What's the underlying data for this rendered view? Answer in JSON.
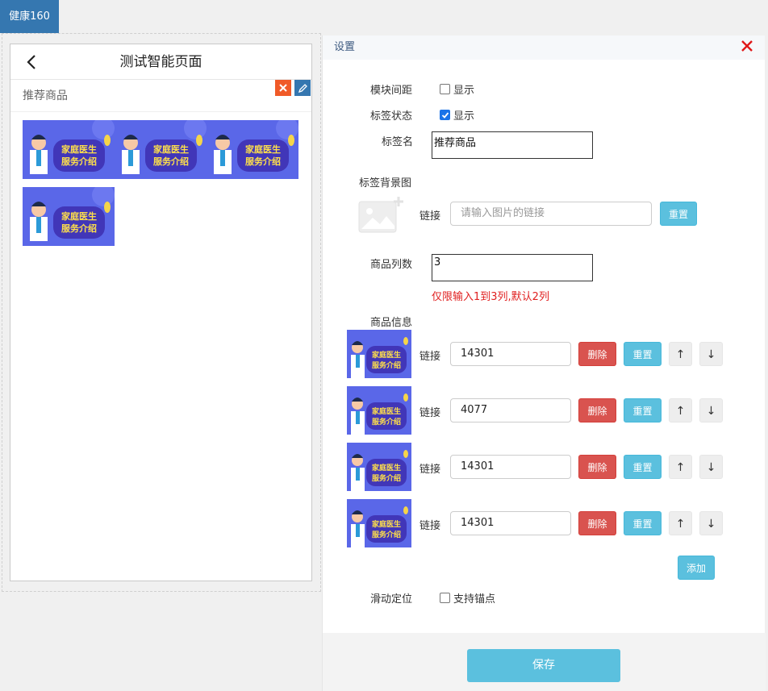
{
  "brand": "健康160",
  "phone": {
    "title": "测试智能页面",
    "module_label": "推荐商品",
    "product_banner_text_1": "家庭医生",
    "product_banner_text_2": "服务介绍"
  },
  "panel": {
    "title": "设置",
    "module_spacing_label": "模块间距",
    "module_spacing_option": "显示",
    "module_spacing_checked": false,
    "tag_status_label": "标签状态",
    "tag_status_option": "显示",
    "tag_status_checked": true,
    "tag_name_label": "标签名",
    "tag_name_value": "推荐商品",
    "tag_bg_label": "标签背景图",
    "link_label": "链接",
    "tag_bg_placeholder": "请输入图片的链接",
    "reset_label": "重置",
    "columns_label": "商品列数",
    "columns_value": "3",
    "columns_hint": "仅限输入1到3列,默认2列",
    "products_label": "商品信息",
    "products": [
      {
        "link": "14301"
      },
      {
        "link": "4077"
      },
      {
        "link": "14301"
      },
      {
        "link": "14301"
      }
    ],
    "delete_label": "删除",
    "up_label": "↑",
    "down_label": "↓",
    "add_label": "添加",
    "scroll_label": "滑动定位",
    "scroll_option": "支持锚点",
    "scroll_checked": false,
    "save_label": "保存"
  },
  "colors": {
    "brand": "#3577b0",
    "info": "#5bc0de",
    "danger": "#d9534f",
    "hint": "#e02020",
    "banner": "#5a67e8"
  }
}
